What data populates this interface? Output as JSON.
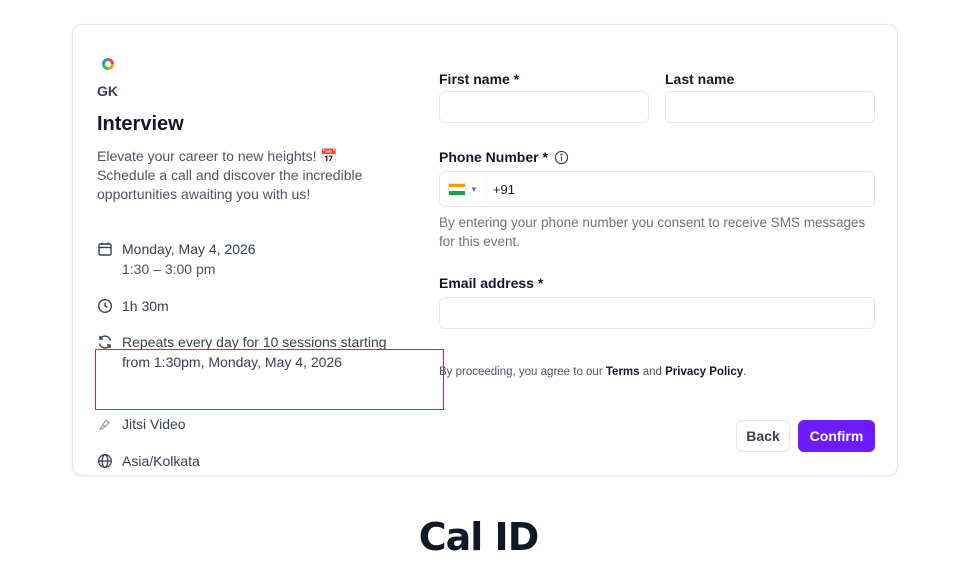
{
  "event": {
    "org_name": "GK",
    "title": "Interview",
    "description": "Elevate your career to new heights! 📅 Schedule a call and discover the incredible opportunities awaiting you with us!",
    "date": "Monday, May 4, 2026",
    "time_range": "1:30 – 3:00 pm",
    "duration": "1h 30m",
    "recurrence": "Repeats every day for 10 sessions starting from 1:30pm, Monday, May 4, 2026",
    "location": "Jitsi Video",
    "timezone": "Asia/Kolkata"
  },
  "form": {
    "first_name_label": "First name *",
    "first_name_value": "",
    "last_name_label": "Last name",
    "last_name_value": "",
    "phone_label": "Phone Number *",
    "phone_country_code": "+91",
    "phone_hint": "By entering your phone number you consent to receive SMS messages for this event.",
    "email_label": "Email address *",
    "email_value": "",
    "legal_prefix": "By proceeding, you agree to our",
    "legal_terms": "Terms",
    "legal_and": "and",
    "legal_privacy": "Privacy Policy",
    "legal_suffix": ".",
    "back_label": "Back",
    "confirm_label": "Confirm"
  },
  "brand": {
    "name": "Cal ID"
  },
  "colors": {
    "accent": "#6d1cff",
    "highlight_border": "#e11d48"
  },
  "icons": {
    "org_logo": "org-logo-icon",
    "date": "calendar-icon",
    "duration": "clock-icon",
    "recurrence": "repeat-icon",
    "location": "video-icon",
    "timezone": "globe-icon",
    "info": "info-icon"
  }
}
